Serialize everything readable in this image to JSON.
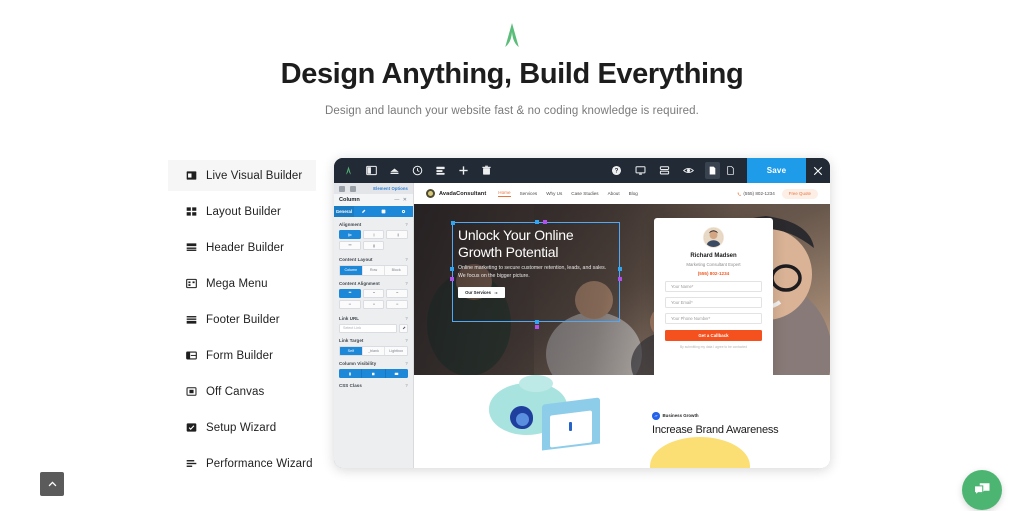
{
  "header": {
    "logo_icon": "avada-a-logo-icon",
    "title": "Design Anything, Build Everything",
    "subtitle": "Design and launch your website fast & no coding knowledge is required.",
    "logo_color": "#5bbd7a"
  },
  "sidebar": {
    "items": [
      {
        "label": "Live Visual Builder",
        "icon": "visual-builder-icon",
        "active": true
      },
      {
        "label": "Layout Builder",
        "icon": "layout-builder-icon",
        "active": false
      },
      {
        "label": "Header Builder",
        "icon": "header-builder-icon",
        "active": false
      },
      {
        "label": "Mega Menu",
        "icon": "mega-menu-icon",
        "active": false
      },
      {
        "label": "Footer Builder",
        "icon": "footer-builder-icon",
        "active": false
      },
      {
        "label": "Form Builder",
        "icon": "form-builder-icon",
        "active": false
      },
      {
        "label": "Off Canvas",
        "icon": "off-canvas-icon",
        "active": false
      },
      {
        "label": "Setup Wizard",
        "icon": "setup-wizard-icon",
        "active": false
      },
      {
        "label": "Performance Wizard",
        "icon": "performance-wizard-icon",
        "active": false
      }
    ]
  },
  "builder": {
    "toolbar": {
      "logo_icon": "avada-logo-icon",
      "left_icons": [
        "sidebar-toggle-icon",
        "library-icon",
        "history-icon",
        "layers-icon",
        "add-element-icon",
        "trash-icon"
      ],
      "right_icons": [
        "help-icon",
        "desktop-preview-icon",
        "wireframe-icon",
        "preview-eye-icon"
      ],
      "device_icons": [
        "page-icon",
        "page-outline-icon"
      ],
      "save_label": "Save",
      "close_icon": "close-icon",
      "save_color": "#1e9cea",
      "bar_color": "#222a35"
    },
    "panel": {
      "header_label": "Element Options",
      "element_title": "Column",
      "collapse_icon": "minimize-icon",
      "close_icon": "close-icon",
      "tabs": [
        {
          "label": "General",
          "selected": true
        },
        {
          "label": "design-tab-icon",
          "selected": false
        },
        {
          "label": "extras-tab-icon",
          "selected": false
        },
        {
          "label": "settings-tab-icon",
          "selected": false
        }
      ],
      "sections": [
        {
          "title": "Alignment"
        },
        {
          "title": "Content Layout",
          "options": [
            "Column",
            "Row",
            "Block"
          ],
          "selected": "Column"
        },
        {
          "title": "Content Alignment"
        },
        {
          "title": "Link URL",
          "placeholder": "Select Link"
        },
        {
          "title": "Link Target",
          "options": [
            "Self",
            "_blank",
            "Lightbox"
          ],
          "selected": "Self"
        },
        {
          "title": "Column Visibility"
        },
        {
          "title": "CSS Class"
        }
      ],
      "accent_color": "#1e88d8"
    },
    "site": {
      "nav": {
        "brand": "AvadaConsultant",
        "links": [
          "Home",
          "Services",
          "Why Us",
          "Case Studies",
          "About",
          "Blog"
        ],
        "active_link": "Home",
        "phone": "(555) 802-1234",
        "phone_icon": "phone-icon",
        "cta": "Free Quote",
        "accent_color": "#e8743b"
      },
      "hero": {
        "heading": "Unlock Your Online Growth Potential",
        "paragraph": "Online marketing to secure customer retention, leads, and sales. We focus on the bigger picture.",
        "button": "Our Services",
        "button_icon": "arrow-right-icon",
        "selection_color": "#53a8f5"
      },
      "card": {
        "avatar_icon": "consultant-avatar",
        "name": "Richard Madsen",
        "role": "Marketing Consultant Expert",
        "phone": "(555) 802-1234",
        "phone_icon": "phone-icon",
        "fields": [
          "Your Name*",
          "Your Email*",
          "Your Phone Number*"
        ],
        "submit": "Get a Callback",
        "fineprint": "By submitting my data I agree to be contacted",
        "submit_color": "#f4511e"
      },
      "lower": {
        "tag": "Business Growth",
        "tag_icon": "growth-badge-icon",
        "heading": "Increase Brand Awareness",
        "tag_color": "#2563eb"
      }
    }
  },
  "widgets": {
    "scroll_top_icon": "chevron-up-icon",
    "scroll_top_color": "#5b5b5b",
    "chat_icon": "chat-bubbles-icon",
    "chat_color": "#4cb572"
  }
}
